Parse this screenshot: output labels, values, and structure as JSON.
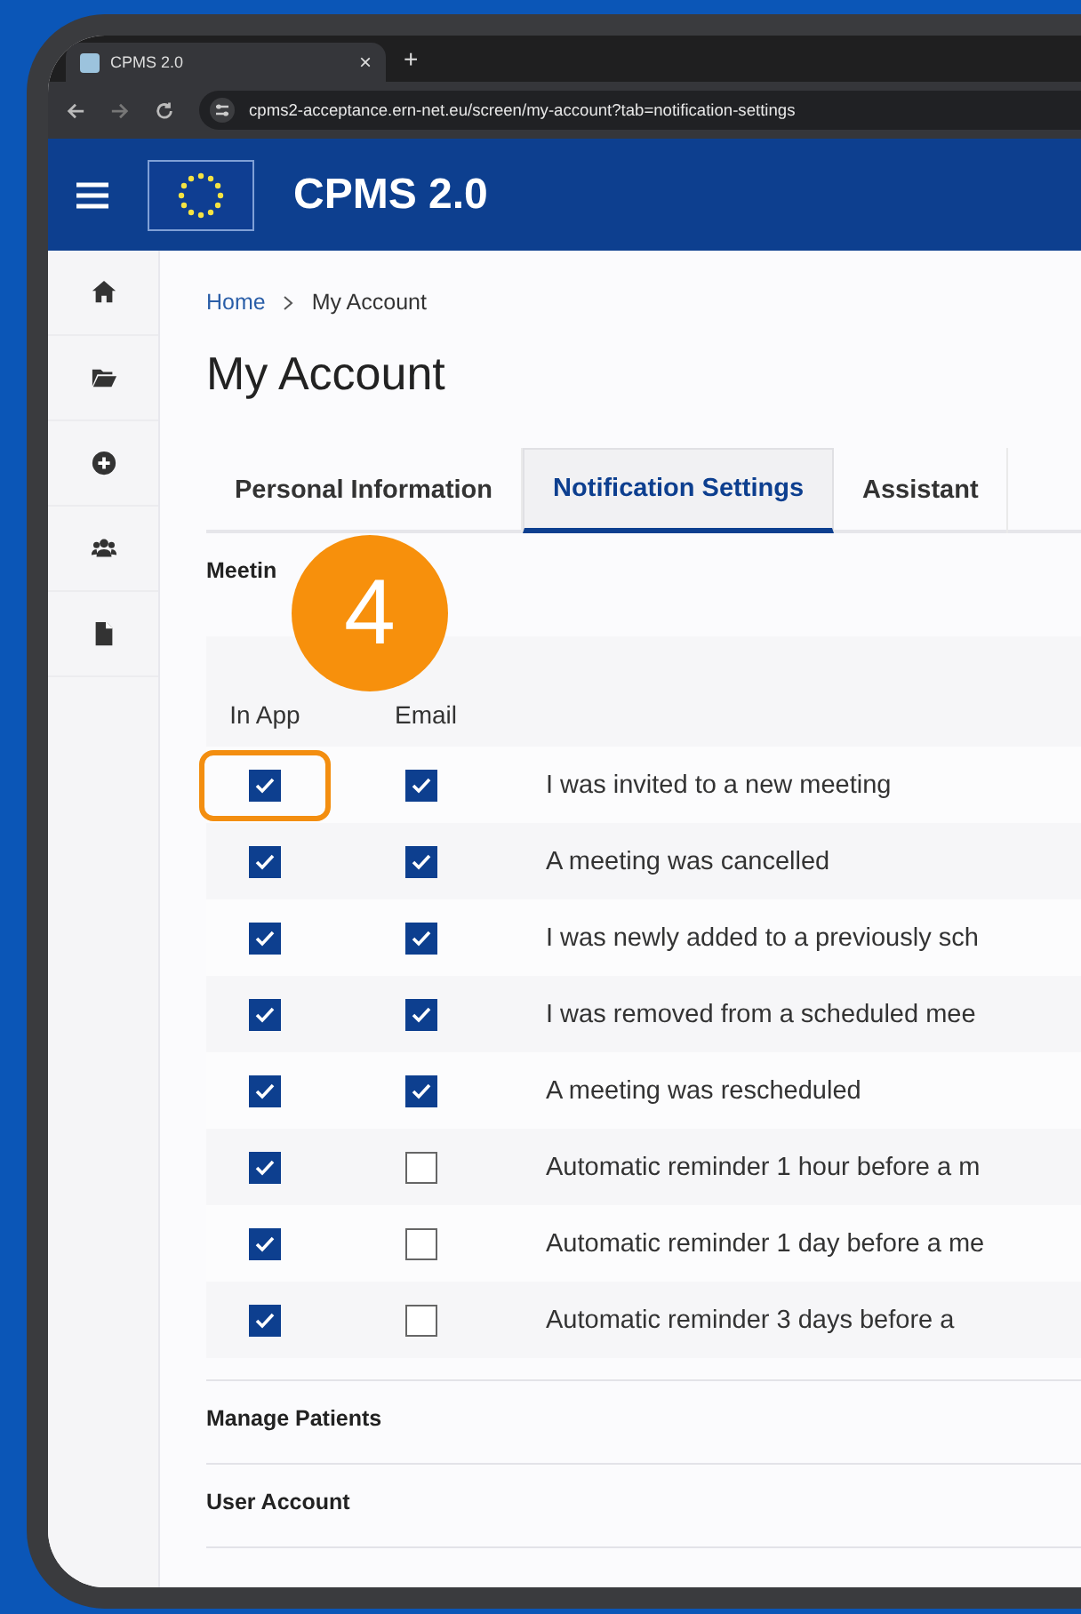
{
  "browser": {
    "tab_title": "CPMS 2.0",
    "tab_close": "×",
    "new_tab": "+",
    "url": "cpms2-acceptance.ern-net.eu/screen/my-account?tab=notification-settings"
  },
  "header": {
    "app_name": "CPMS 2.0"
  },
  "breadcrumb": [
    {
      "label": "Home",
      "kind": "link"
    },
    {
      "label": "My Account",
      "kind": "current"
    }
  ],
  "page_title": "My Account",
  "tabs": [
    {
      "label": "Personal Information",
      "selected": false
    },
    {
      "label": "Notification Settings",
      "selected": true
    },
    {
      "label": "Assistant",
      "selected": false
    }
  ],
  "step_badge": "4",
  "sections": [
    {
      "title": "Meetin",
      "columns": [
        "In App",
        "Email"
      ],
      "rows": [
        {
          "label": "I was invited to a new meeting",
          "in_app": true,
          "email": true,
          "highlighted": true
        },
        {
          "label": "A meeting was cancelled",
          "in_app": true,
          "email": true,
          "highlighted": false
        },
        {
          "label": "I was newly added to a previously sch",
          "in_app": true,
          "email": true,
          "highlighted": false
        },
        {
          "label": "I was removed from a scheduled mee",
          "in_app": true,
          "email": true,
          "highlighted": false
        },
        {
          "label": "A meeting was rescheduled",
          "in_app": true,
          "email": true,
          "highlighted": false
        },
        {
          "label": "Automatic reminder 1 hour before a m",
          "in_app": true,
          "email": false,
          "highlighted": false
        },
        {
          "label": "Automatic reminder 1 day before a me",
          "in_app": true,
          "email": false,
          "highlighted": false
        },
        {
          "label": "Automatic reminder 3 days before a",
          "in_app": true,
          "email": false,
          "highlighted": false
        }
      ]
    },
    {
      "title": "Manage Patients"
    },
    {
      "title": "User Account"
    }
  ]
}
